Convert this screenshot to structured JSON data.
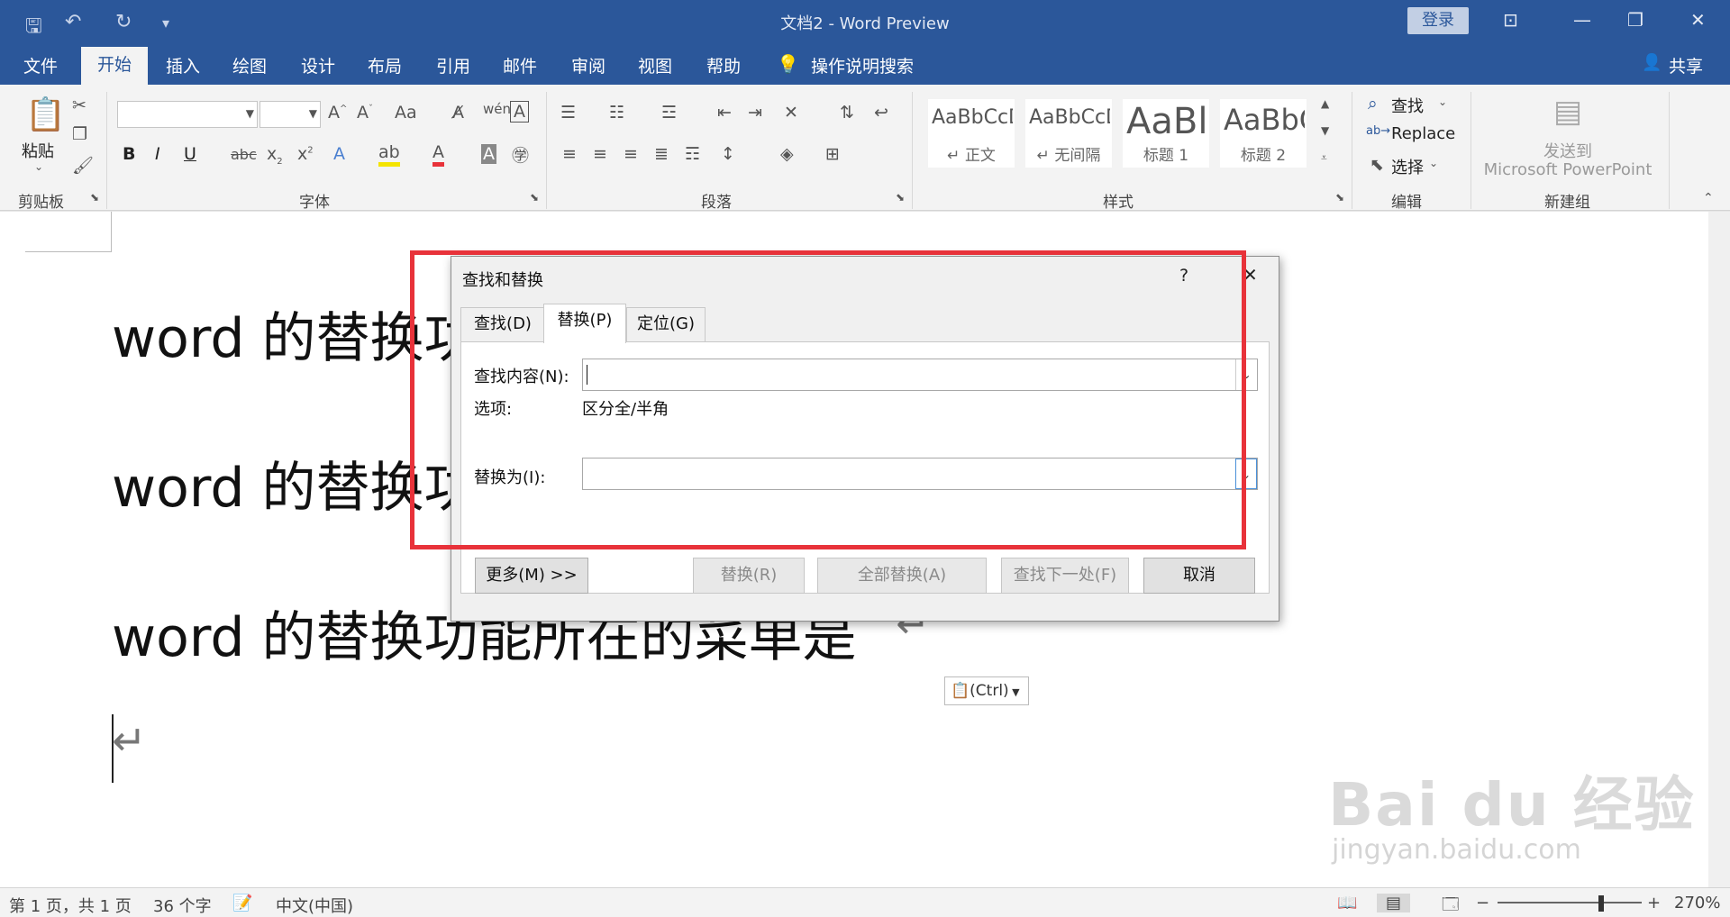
{
  "window": {
    "title": "文档2  -  Word Preview",
    "login_label": "登录",
    "qa_save": "🖫",
    "qa_undo": "↶",
    "qa_redo": "↻",
    "qa_more": "▾",
    "win_ribbon_opt": "⊡",
    "win_minimize": "—",
    "win_restore": "❐",
    "win_close": "✕"
  },
  "tabs": [
    "文件",
    "开始",
    "插入",
    "绘图",
    "设计",
    "布局",
    "引用",
    "邮件",
    "审阅",
    "视图",
    "帮助"
  ],
  "tell_me": "操作说明搜索",
  "share_label": "共享",
  "ribbon": {
    "clipboard_label": "剪贴板",
    "paste_label": "粘贴",
    "font_label": "字体",
    "paragraph_label": "段落",
    "styles_label": "样式",
    "editing_label": "编辑",
    "newgroup_label": "新建组",
    "styles": [
      {
        "sample": "AaBbCcDc",
        "name": "↵ 正文"
      },
      {
        "sample": "AaBbCcDc",
        "name": "↵ 无间隔"
      },
      {
        "sample": "AaBl",
        "name": "标题 1"
      },
      {
        "sample": "AaBbC",
        "name": "标题 2"
      }
    ],
    "find_label": "查找",
    "replace_label": "Replace",
    "select_label": "选择",
    "send_to_1": "发送到",
    "send_to_2": "Microsoft PowerPoint"
  },
  "document": {
    "lines": [
      "word 的替换功能所在的菜单是",
      "word 的替换功能所在的菜单是",
      "word 的替换功能所在的菜单是"
    ],
    "para_mark": "↵",
    "paste_ctrl": "(Ctrl)"
  },
  "dialog": {
    "title": "查找和替换",
    "help": "?",
    "close": "✕",
    "tabs": [
      "查找(D)",
      "替换(P)",
      "定位(G)"
    ],
    "find_label": "查找内容(N):",
    "find_value": "",
    "options_label": "选项:",
    "options_value": "区分全/半角",
    "replace_label": "替换为(I):",
    "replace_value": "",
    "buttons": {
      "more": "更多(M) >>",
      "replace": "替换(R)",
      "replace_all": "全部替换(A)",
      "find_next": "查找下一处(F)",
      "cancel": "取消"
    }
  },
  "status": {
    "page": "第 1 页，共 1 页",
    "words": "36 个字",
    "language": "中文(中国)",
    "zoom": "270%"
  },
  "watermark": {
    "brand": "Bai du 经验",
    "url": "jingyan.baidu.com"
  },
  "colors": {
    "titlebar": "#2b579a",
    "annotation": "#e8323a"
  }
}
